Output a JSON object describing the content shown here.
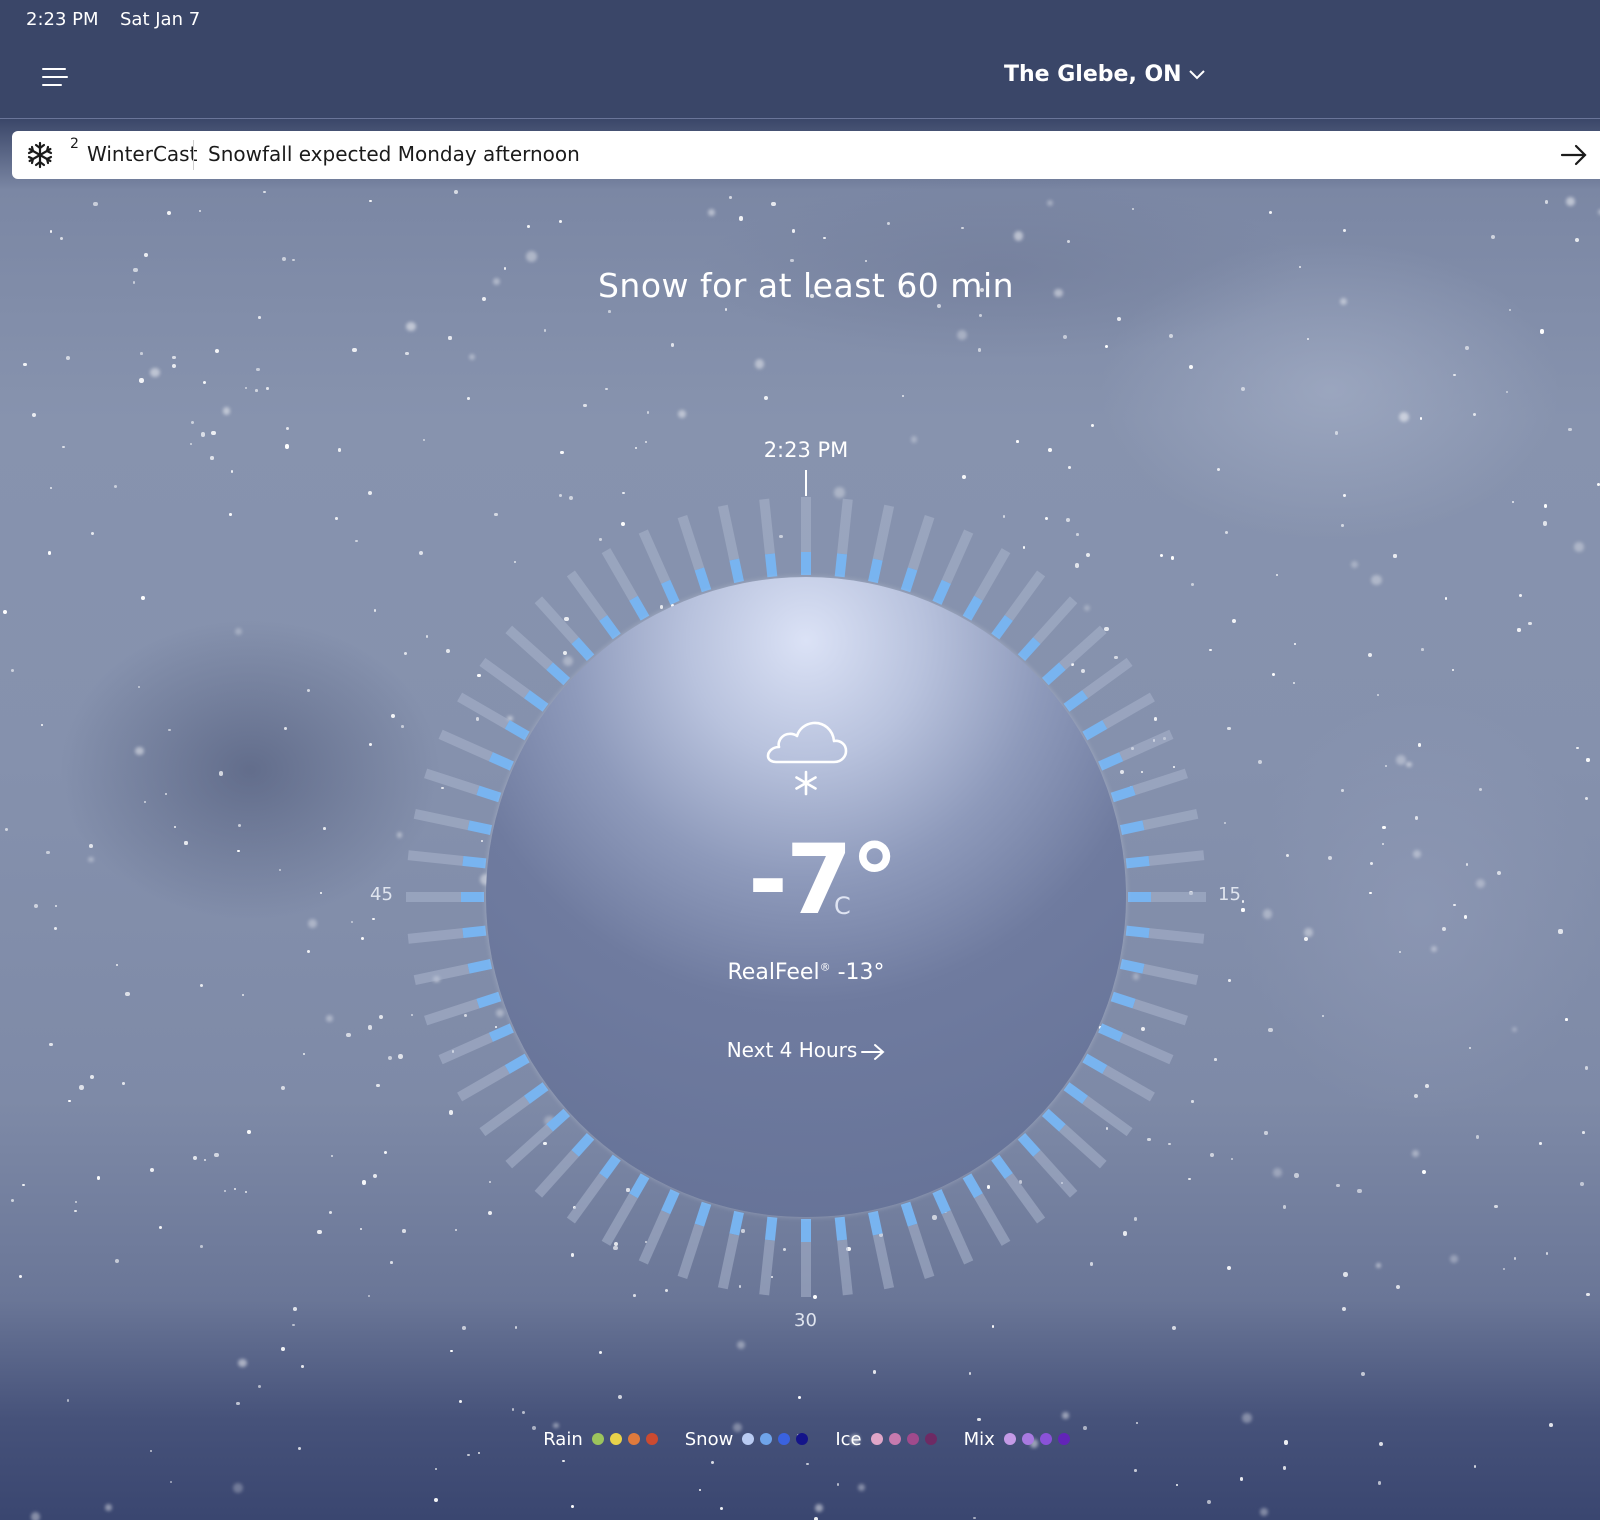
{
  "status_bar": {
    "time": "2:23 PM",
    "date": "Sat Jan 7"
  },
  "header": {
    "location": "The Glebe, ON",
    "menu_icon": "hamburger-menu-icon",
    "location_chevron_icon": "chevron-down-icon"
  },
  "banner": {
    "icon": "snowflake-icon",
    "badge": "2",
    "brand": "WinterCast",
    "message": "Snowfall expected Monday afternoon",
    "arrow_icon": "arrow-right-icon"
  },
  "headline": "Snow for at least 60 min",
  "dial": {
    "current_time": "2:23 PM",
    "labels": {
      "top": "",
      "right": "15",
      "bottom": "30",
      "left": "45"
    },
    "minutes_with_snow": 60,
    "minutes_total": 60,
    "snow_color": "#78b4f0",
    "tick_color": "#aab4cc"
  },
  "current": {
    "condition_icon": "cloud-snow-icon",
    "temperature": "-7°",
    "unit": "C",
    "realfeel_label": "RealFeel",
    "realfeel_mark": "®",
    "realfeel_value": "-13°",
    "next_hours": "Next 4 Hours",
    "next_hours_icon": "arrow-right-icon"
  },
  "legend": [
    {
      "label": "Rain",
      "colors": [
        "#9cc45c",
        "#e8d24a",
        "#e07a3c",
        "#cc4a30"
      ]
    },
    {
      "label": "Snow",
      "colors": [
        "#b9cbf2",
        "#6fa4ea",
        "#3a62e0",
        "#14148a"
      ]
    },
    {
      "label": "Ice",
      "colors": [
        "#e0a6c8",
        "#c77aae",
        "#a04a8c",
        "#6e2a64"
      ]
    },
    {
      "label": "Mix",
      "colors": [
        "#c49ae6",
        "#a87ae0",
        "#8a52d8",
        "#6224b8"
      ]
    }
  ]
}
